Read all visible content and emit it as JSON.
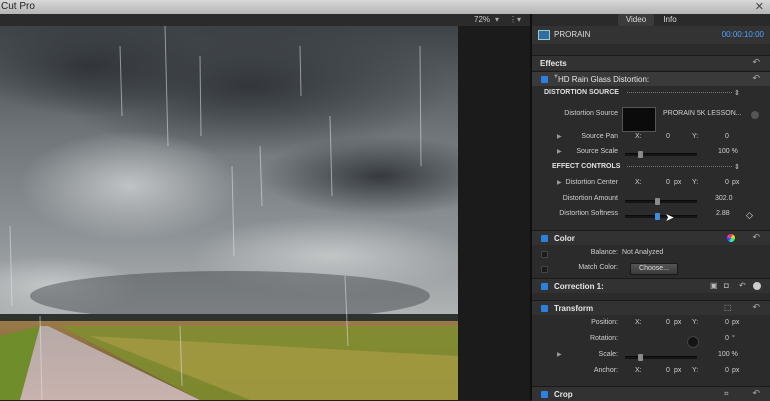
{
  "window": {
    "title": "Cut Pro"
  },
  "viewer": {
    "zoom": "72%"
  },
  "inspector": {
    "tabs": [
      "Video",
      "Info"
    ],
    "clip_name": "PRORAIN",
    "timecode": "00:00:10:00",
    "effects_title": "Effects",
    "effect_name": "HD Rain Glass Distortion:",
    "distortion_source_header": "DISTORTION SOURCE",
    "distortion_source_label": "Distortion Source",
    "distortion_source_value": "PRORAIN 5K LESSON...",
    "source_pan": {
      "label": "Source Pan",
      "x_label": "X:",
      "x": "0",
      "y_label": "Y:",
      "y": "0"
    },
    "source_scale": {
      "label": "Source Scale",
      "value": "100 %",
      "level": 0.2
    },
    "effect_controls_header": "EFFECT CONTROLS",
    "distortion_center": {
      "label": "Distortion Center",
      "x_label": "X:",
      "x": "0",
      "x_unit": "px",
      "y_label": "Y:",
      "y": "0",
      "y_unit": "px"
    },
    "distortion_amount": {
      "label": "Distortion Amount",
      "value": "302.0",
      "level": 0.45
    },
    "distortion_softness": {
      "label": "Distortion Softness",
      "value": "2.88",
      "level": 0.45
    },
    "color_title": "Color",
    "balance": {
      "label": "Balance:",
      "value": "Not Analyzed"
    },
    "match_color": {
      "label": "Match Color:",
      "button": "Choose..."
    },
    "correction_title": "Correction 1:",
    "transform_title": "Transform",
    "position": {
      "label": "Position:",
      "x_label": "X:",
      "x": "0",
      "x_unit": "px",
      "y_label": "Y:",
      "y": "0",
      "y_unit": "px"
    },
    "rotation": {
      "label": "Rotation:",
      "value": "0",
      "unit": "°"
    },
    "scale": {
      "label": "Scale:",
      "value": "100 %",
      "level": 0.2
    },
    "anchor": {
      "label": "Anchor:",
      "x_label": "X:",
      "x": "0",
      "x_unit": "px",
      "y_label": "Y:",
      "y": "0",
      "y_unit": "px"
    },
    "crop_title": "Crop"
  },
  "colors": {
    "accent": "#2d7fe0",
    "timecode": "#4ea3ff"
  },
  "icons": [
    "close-icon",
    "undo-icon",
    "chevron-right-icon",
    "color-wheel-icon",
    "crop-icon",
    "transform-icon",
    "mask-icon",
    "reset-icon"
  ]
}
